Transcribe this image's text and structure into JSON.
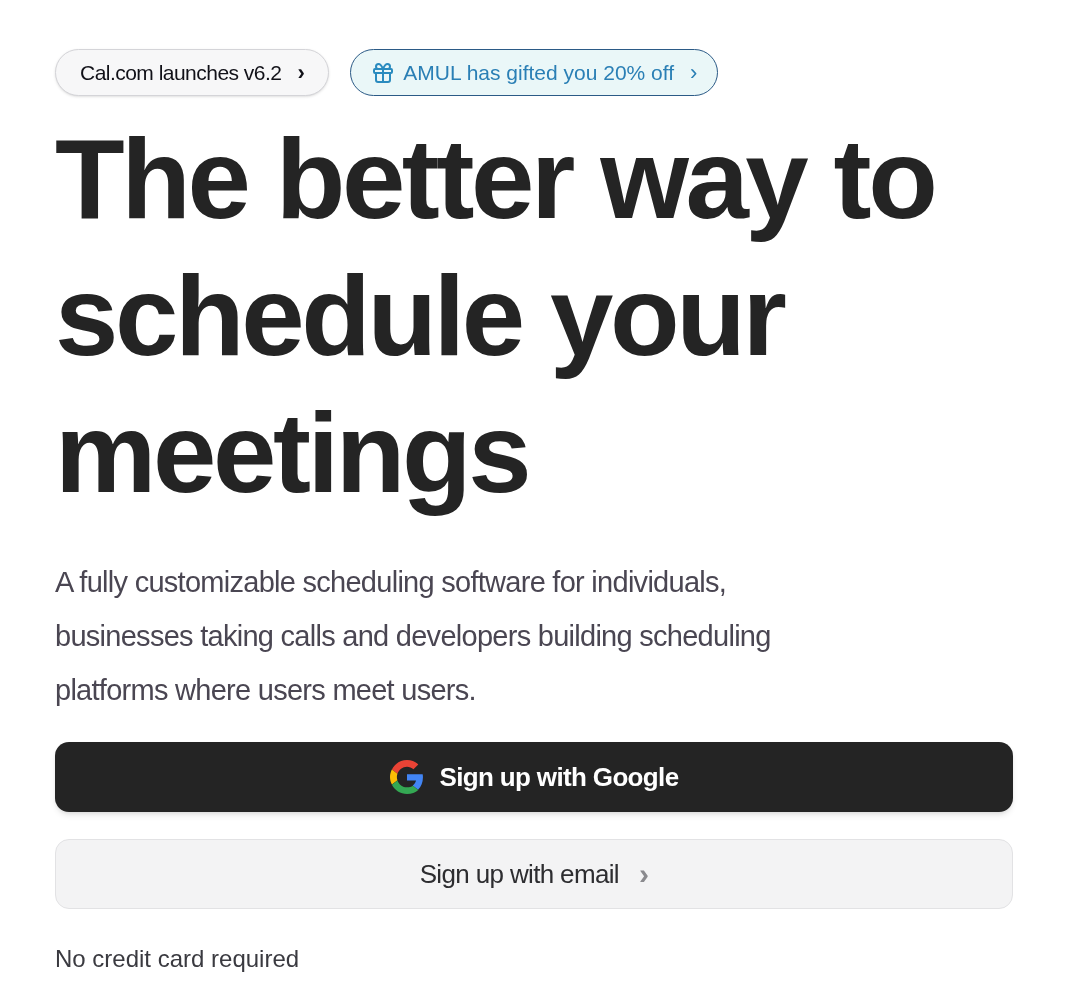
{
  "badges": [
    {
      "kind": "announcement",
      "label": "Cal.com launches v6.2",
      "chevron": "›"
    },
    {
      "kind": "offer",
      "label": "AMUL has gifted you 20% off",
      "chevron": "›"
    }
  ],
  "headline_lines": [
    "The better way to",
    "schedule your",
    "meetings"
  ],
  "description_lines": [
    "A fully customizable scheduling software for individuals,",
    "businesses taking calls and developers building scheduling",
    "platforms where users meet users."
  ],
  "buttons": [
    {
      "kind": "google",
      "label": "Sign up with Google"
    },
    {
      "kind": "email",
      "label": "Sign up with email",
      "chevron": "›"
    }
  ],
  "footnote": "No credit card required"
}
